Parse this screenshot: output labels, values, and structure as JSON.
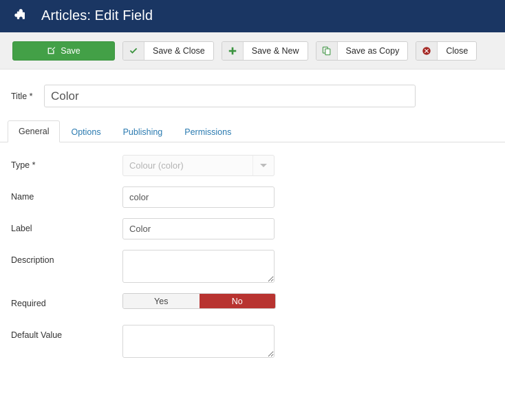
{
  "header": {
    "icon": "puzzle-piece-icon",
    "title": "Articles: Edit Field"
  },
  "toolbar": {
    "buttons": [
      {
        "label": "Save",
        "icon": "pencil-square-icon",
        "style": "primary-green"
      },
      {
        "label": "Save & Close",
        "icon": "check-icon",
        "style": "default"
      },
      {
        "label": "Save & New",
        "icon": "plus-icon",
        "style": "default"
      },
      {
        "label": "Save as Copy",
        "icon": "copy-icon",
        "style": "default"
      },
      {
        "label": "Close",
        "icon": "close-circle-icon",
        "style": "default"
      }
    ]
  },
  "title_field": {
    "label": "Title *",
    "value": "Color",
    "placeholder": ""
  },
  "tabs": [
    {
      "label": "General",
      "active": true
    },
    {
      "label": "Options",
      "active": false
    },
    {
      "label": "Publishing",
      "active": false
    },
    {
      "label": "Permissions",
      "active": false
    }
  ],
  "form": {
    "type": {
      "label": "Type *",
      "value": "Colour (color)",
      "disabled": true
    },
    "name": {
      "label": "Name",
      "value": "color"
    },
    "label_field": {
      "label": "Label",
      "value": "Color"
    },
    "description": {
      "label": "Description",
      "value": ""
    },
    "required": {
      "label": "Required",
      "yes": "Yes",
      "no": "No",
      "selected": "No"
    },
    "default_value": {
      "label": "Default Value",
      "value": ""
    }
  },
  "colors": {
    "header_bg": "#1a3663",
    "toolbar_bg": "#f0f0f0",
    "primary_green": "#43a047",
    "toggle_active_red": "#b83330",
    "link_blue": "#2a7ab0",
    "close_icon_red": "#a52824"
  }
}
